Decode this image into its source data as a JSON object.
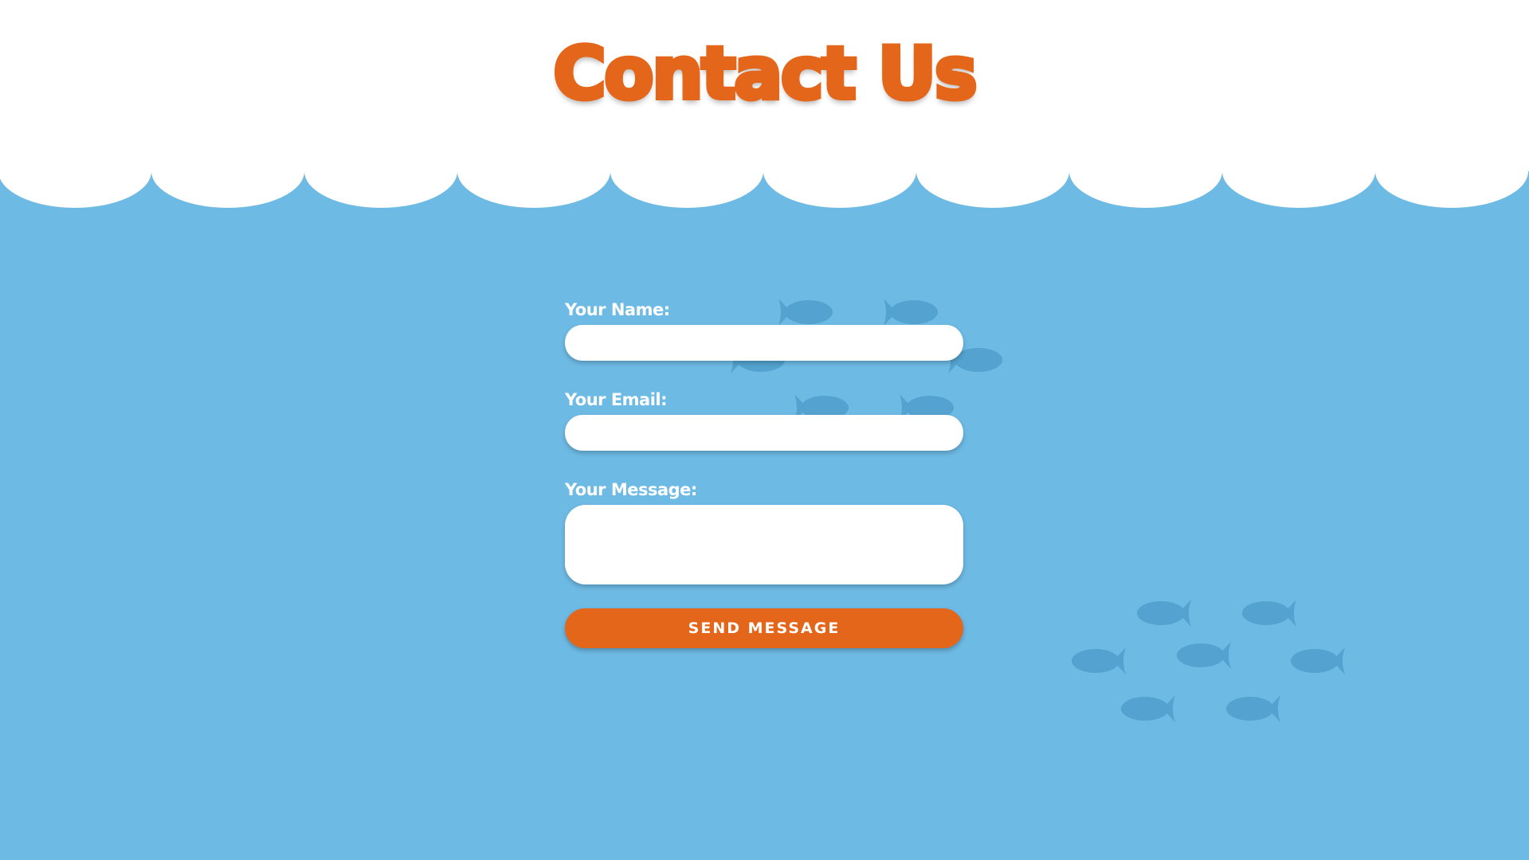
{
  "page": {
    "title": "Contact Us"
  },
  "form": {
    "name_label": "Your Name:",
    "name_value": "",
    "email_label": "Your Email:",
    "email_value": "",
    "message_label": "Your Message:",
    "message_value": "",
    "submit_label": "SEND MESSAGE"
  },
  "colors": {
    "background": "#6dbae5",
    "header": "#ffffff",
    "accent": "#e3661a",
    "fish": "#4e9ecb"
  },
  "decorations": {
    "fish_icon": "fish-icon",
    "cloud_edge": "scalloped-edge"
  }
}
